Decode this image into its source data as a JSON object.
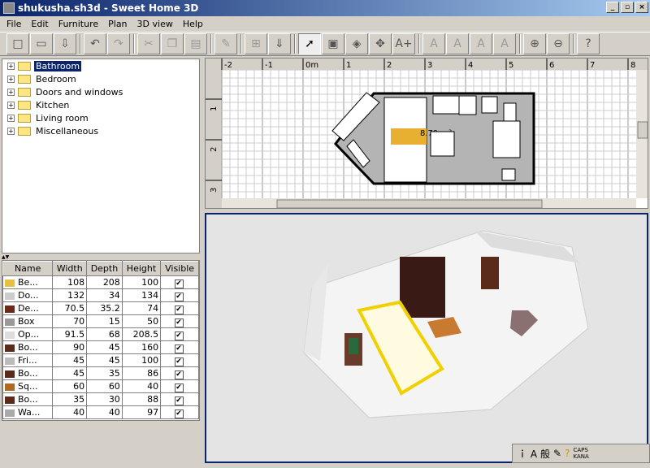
{
  "window": {
    "title": "shukusha.sh3d - Sweet Home 3D"
  },
  "menu": [
    "File",
    "Edit",
    "Furniture",
    "Plan",
    "3D view",
    "Help"
  ],
  "toolbar": [
    {
      "icon": "new-icon",
      "glyph": "□"
    },
    {
      "icon": "open-icon",
      "glyph": "▭"
    },
    {
      "icon": "save-icon",
      "glyph": "⇩"
    },
    {
      "sep": true
    },
    {
      "icon": "undo-icon",
      "glyph": "↶"
    },
    {
      "icon": "redo-icon",
      "glyph": "↷",
      "disabled": true
    },
    {
      "sep": true
    },
    {
      "icon": "cut-icon",
      "glyph": "✂",
      "disabled": true
    },
    {
      "icon": "copy-icon",
      "glyph": "❐",
      "disabled": true
    },
    {
      "icon": "paste-icon",
      "glyph": "▤",
      "disabled": true
    },
    {
      "sep": true
    },
    {
      "icon": "delete-icon",
      "glyph": "✎",
      "disabled": true
    },
    {
      "sep": true
    },
    {
      "icon": "add-furniture-icon",
      "glyph": "⊞",
      "disabled": true
    },
    {
      "icon": "import-furniture-icon",
      "glyph": "⇓"
    },
    {
      "sep": true
    },
    {
      "icon": "select-icon",
      "glyph": "➚",
      "active": true
    },
    {
      "icon": "create-walls-icon",
      "glyph": "▣"
    },
    {
      "icon": "create-rooms-icon",
      "glyph": "◈"
    },
    {
      "icon": "create-dimensions-icon",
      "glyph": "✥"
    },
    {
      "icon": "add-text-icon",
      "glyph": "A+"
    },
    {
      "sep": true
    },
    {
      "icon": "text-style-icon",
      "glyph": "A",
      "disabled": true
    },
    {
      "icon": "increase-text-icon",
      "glyph": "A",
      "disabled": true
    },
    {
      "icon": "bold-text-icon",
      "glyph": "A",
      "disabled": true
    },
    {
      "icon": "italic-text-icon",
      "glyph": "A",
      "disabled": true
    },
    {
      "sep": true
    },
    {
      "icon": "zoom-in-icon",
      "glyph": "⊕"
    },
    {
      "icon": "zoom-out-icon",
      "glyph": "⊖"
    },
    {
      "sep": true
    },
    {
      "icon": "help-icon",
      "glyph": "?"
    }
  ],
  "catalog": [
    {
      "label": "Bathroom",
      "selected": true
    },
    {
      "label": "Bedroom"
    },
    {
      "label": "Doors and windows"
    },
    {
      "label": "Kitchen"
    },
    {
      "label": "Living room"
    },
    {
      "label": "Miscellaneous"
    }
  ],
  "furniture": {
    "columns": [
      "Name",
      "Width",
      "Depth",
      "Height",
      "Visible"
    ],
    "rows": [
      {
        "name": "Be...",
        "width": "108",
        "depth": "208",
        "height": "100",
        "visible": true,
        "color": "#e8c040"
      },
      {
        "name": "Do...",
        "width": "132",
        "depth": "34",
        "height": "134",
        "visible": true,
        "color": "#ccc"
      },
      {
        "name": "De...",
        "width": "70.5",
        "depth": "35.2",
        "height": "74",
        "visible": true,
        "color": "#6a2a1a"
      },
      {
        "name": "Box",
        "width": "70",
        "depth": "15",
        "height": "50",
        "visible": true,
        "color": "#999"
      },
      {
        "name": "Op...",
        "width": "91.5",
        "depth": "68",
        "height": "208.5",
        "visible": true,
        "color": "#ddd"
      },
      {
        "name": "Bo...",
        "width": "90",
        "depth": "45",
        "height": "160",
        "visible": true,
        "color": "#5a2a1a"
      },
      {
        "name": "Fri...",
        "width": "45",
        "depth": "45",
        "height": "100",
        "visible": true,
        "color": "#bbb"
      },
      {
        "name": "Bo...",
        "width": "45",
        "depth": "35",
        "height": "86",
        "visible": true,
        "color": "#5a2a1a"
      },
      {
        "name": "Sq...",
        "width": "60",
        "depth": "60",
        "height": "40",
        "visible": true,
        "color": "#b06a20"
      },
      {
        "name": "Bo...",
        "width": "35",
        "depth": "30",
        "height": "88",
        "visible": true,
        "color": "#5a2a1a"
      },
      {
        "name": "Wa...",
        "width": "40",
        "depth": "40",
        "height": "97",
        "visible": true,
        "color": "#aaa"
      }
    ]
  },
  "plan": {
    "x_ruler": [
      "-2",
      "-1",
      "0m",
      "1",
      "2",
      "3",
      "4",
      "5",
      "6",
      "7",
      "8"
    ],
    "y_ruler": [
      "1",
      "2",
      "3"
    ],
    "room_area": "8.79 m²"
  },
  "statusbar": {
    "ime": "般",
    "caps": "CAPS",
    "kana": "KANA"
  }
}
